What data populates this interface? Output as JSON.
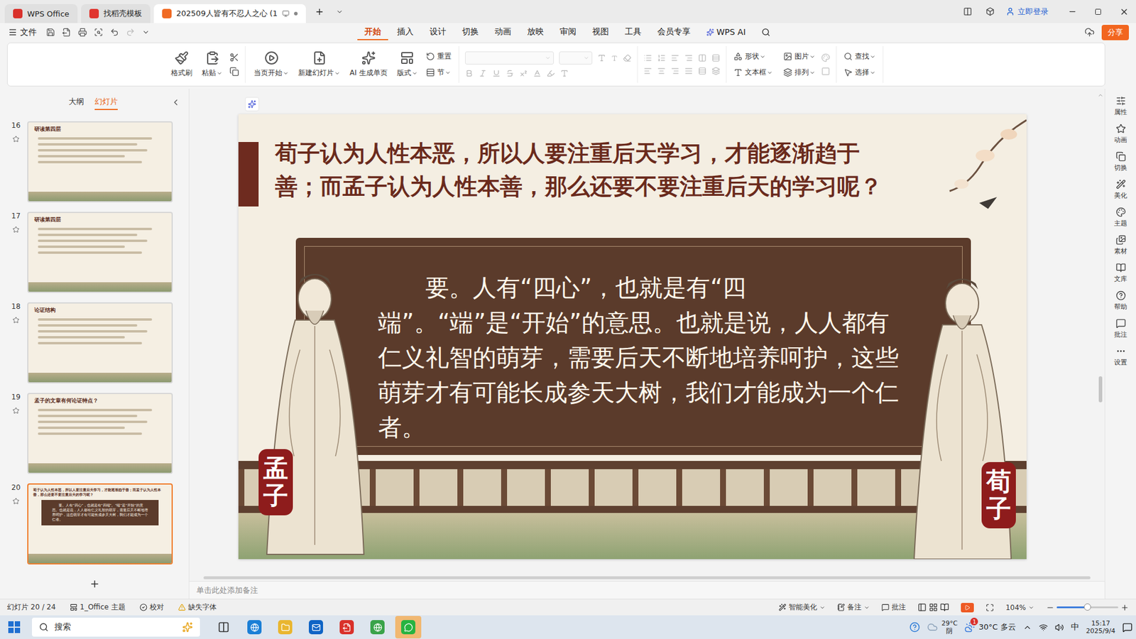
{
  "window": {
    "tabs": [
      {
        "label": "WPS Office",
        "selected": false
      },
      {
        "label": "找稻壳模板",
        "selected": false
      },
      {
        "label": "202509人皆有不忍人之心 (1",
        "selected": true
      }
    ],
    "login": "立即登录"
  },
  "menu": {
    "file": "文件",
    "tabs": [
      {
        "label": "开始",
        "selected": true
      },
      {
        "label": "插入",
        "selected": false
      },
      {
        "label": "设计",
        "selected": false
      },
      {
        "label": "切换",
        "selected": false
      },
      {
        "label": "动画",
        "selected": false
      },
      {
        "label": "放映",
        "selected": false
      },
      {
        "label": "审阅",
        "selected": false
      },
      {
        "label": "视图",
        "selected": false
      },
      {
        "label": "工具",
        "selected": false
      },
      {
        "label": "会员专享",
        "selected": false
      },
      {
        "label": "WPS AI",
        "selected": false
      }
    ],
    "share": "分享"
  },
  "ribbon": {
    "clipboard": [
      {
        "label": "格式刷",
        "dropdown": false
      },
      {
        "label": "粘贴",
        "dropdown": true
      }
    ],
    "slides": [
      {
        "label": "当页开始",
        "dropdown": true
      },
      {
        "label": "新建幻灯片",
        "dropdown": true
      },
      {
        "label": "AI 生成单页",
        "dropdown": false
      },
      {
        "label": "版式",
        "dropdown": true
      }
    ],
    "slide_small": [
      {
        "label": "重置",
        "dropdown": false
      },
      {
        "label": "节",
        "dropdown": true
      }
    ],
    "font_disabled": true,
    "insert": [
      {
        "label": "形状",
        "dropdown": true
      },
      {
        "label": "图片",
        "dropdown": true
      },
      {
        "label": "文本框",
        "dropdown": true
      },
      {
        "label": "排列",
        "dropdown": true
      }
    ],
    "edit": [
      {
        "label": "查找",
        "dropdown": true
      },
      {
        "label": "选择",
        "dropdown": true
      }
    ]
  },
  "panel": {
    "tabs": [
      {
        "label": "大纲",
        "selected": false
      },
      {
        "label": "幻灯片",
        "selected": true
      }
    ],
    "slides": [
      {
        "number": "16",
        "heading": "研读第四层",
        "selected": false,
        "kind": "text"
      },
      {
        "number": "17",
        "heading": "研读第四层",
        "selected": false,
        "kind": "text"
      },
      {
        "number": "18",
        "heading": "论证结构",
        "selected": false,
        "kind": "text"
      },
      {
        "number": "19",
        "heading": "孟子的文章有何论证特点？",
        "selected": false,
        "kind": "text"
      },
      {
        "number": "20",
        "heading": "荀子认为人性本恶，所以人要注重后天学习，才能逐渐趋于善；而孟子认为人性本善，那么还要不要注重后天的学习呢？",
        "selected": true,
        "kind": "current"
      }
    ]
  },
  "slide": {
    "title": "荀子认为人性本恶，所以人要注重后天学习，才能逐渐趋于善；而孟子认为人性本善，那么还要不要注重后天的学习呢？",
    "body": "要。人有“四心”，也就是有“四端”。“端”是“开始”的意思。也就是说，人人都有仁义礼智的萌芽，需要后天不断地培养呵护，这些萌芽才有可能长成参天大树，我们才能成为一个仁者。",
    "left_name": "孟子",
    "right_name": "荀子"
  },
  "notes": {
    "placeholder": "单击此处添加备注"
  },
  "sidebar": {
    "items": [
      "属性",
      "动画",
      "切换",
      "美化",
      "主题",
      "素材",
      "文库",
      "帮助",
      "批注",
      "设置"
    ]
  },
  "status_bar": {
    "slide": "幻灯片 20 / 24",
    "theme": "1_Office 主题",
    "proof": "校对",
    "missing_font": "缺失字体",
    "beautify": "智能美化",
    "notes": "备注",
    "comments": "批注",
    "zoom": "104%",
    "zoom_level": 0.5
  },
  "taskbar": {
    "search": "搜索",
    "apps": [
      {
        "active": false
      },
      {
        "active": false
      },
      {
        "active": false
      },
      {
        "active": false
      },
      {
        "active": false
      },
      {
        "active": true
      }
    ],
    "weather_temp": "29°C",
    "weather_text": "阴",
    "weather2": "30°C 多云",
    "weather_badge": "1",
    "ime": "中",
    "time": "15:17",
    "date": "2025/9/4"
  }
}
